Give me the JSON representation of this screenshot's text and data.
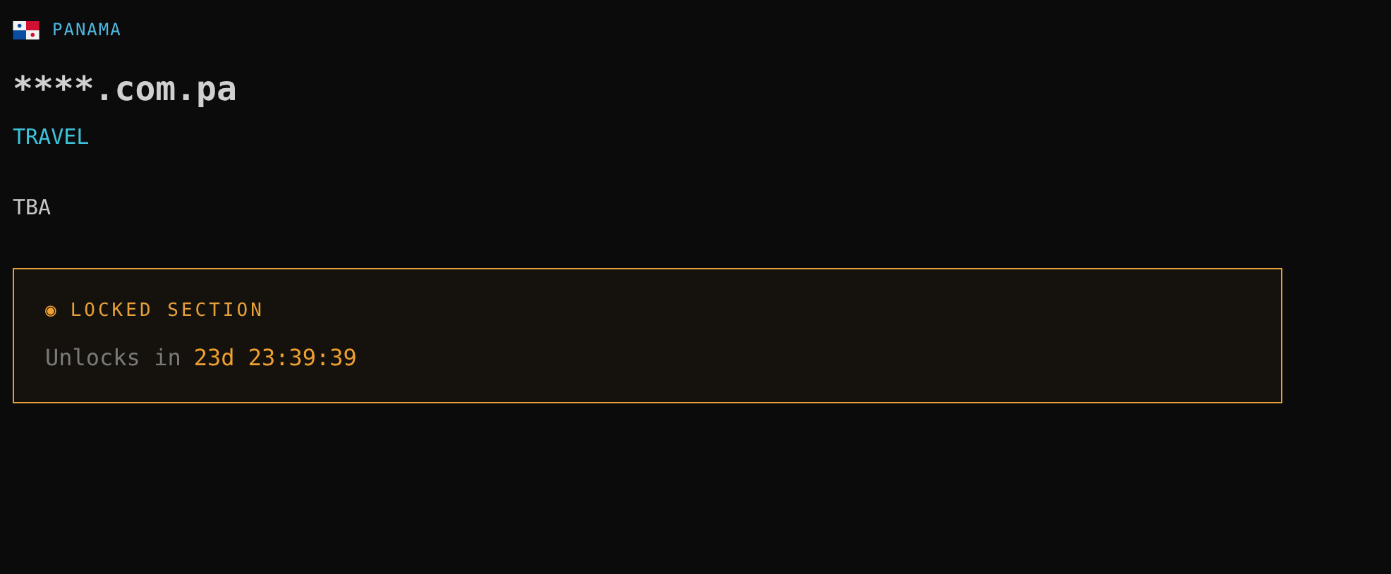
{
  "country": {
    "name": "PANAMA"
  },
  "domain": "****.com.pa",
  "category": "TRAVEL",
  "value": "TBA",
  "locked_section": {
    "icon": "◉",
    "title": "LOCKED SECTION",
    "unlock_label": "Unlocks in",
    "countdown": "23d 23:39:39"
  }
}
